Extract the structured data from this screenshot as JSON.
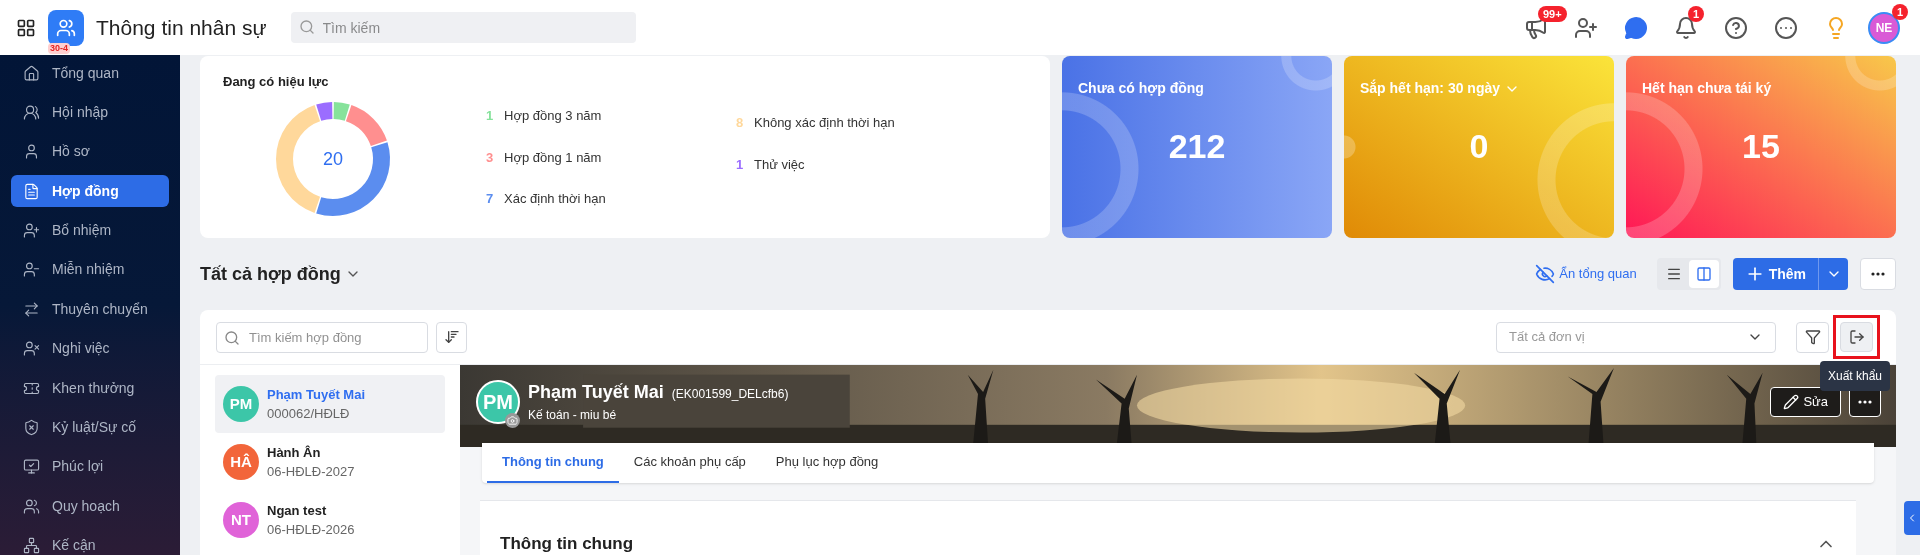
{
  "header": {
    "logo_badge": "30-4",
    "title": "Thông tin nhân sự",
    "search": {
      "placeholder": "Tìm kiếm"
    },
    "actions": [
      {
        "kind": "megaphone",
        "badge": "99+"
      },
      {
        "kind": "user-plus"
      },
      {
        "kind": "chat"
      },
      {
        "kind": "bell",
        "badge": "1"
      },
      {
        "kind": "help"
      },
      {
        "kind": "more"
      },
      {
        "kind": "idea"
      }
    ],
    "avatar": {
      "initials": "NE",
      "badge": "1"
    }
  },
  "sidebar": {
    "items": [
      {
        "label": "Tổng quan",
        "selected": false
      },
      {
        "label": "Hội nhập",
        "selected": false
      },
      {
        "label": "Hồ sơ",
        "selected": false
      },
      {
        "label": "Hợp đồng",
        "selected": true
      },
      {
        "label": "Bổ nhiệm",
        "selected": false
      },
      {
        "label": "Miễn nhiệm",
        "selected": false
      },
      {
        "label": "Thuyên chuyển",
        "selected": false
      },
      {
        "label": "Nghỉ việc",
        "selected": false
      },
      {
        "label": "Khen thưởng",
        "selected": false
      },
      {
        "label": "Kỷ luật/Sự cố",
        "selected": false
      },
      {
        "label": "Phúc lợi",
        "selected": false
      },
      {
        "label": "Quy hoạch",
        "selected": false
      },
      {
        "label": "Kế cận",
        "selected": false
      }
    ]
  },
  "overview": {
    "title": "Đang có hiệu lực",
    "total": "20",
    "chart_data": {
      "type": "donut",
      "categories": [
        "Hợp đồng 3 năm",
        "Hợp đồng 1 năm",
        "Xác định thời hạn",
        "Không xác định thời hạn",
        "Thử việc"
      ],
      "values": [
        5,
        15,
        35,
        40,
        5
      ]
    },
    "legend": [
      {
        "count": "1",
        "color": "#86e29b"
      },
      {
        "count": "3",
        "color": "#ff8f8f"
      },
      {
        "count": "7",
        "color": "#5b8def"
      },
      {
        "count": "8",
        "color": "#ffd89b"
      },
      {
        "count": "1",
        "color": "#9b6dff"
      }
    ]
  },
  "stat_cards": [
    {
      "kind": "blue",
      "title": "Chưa có hợp đồng",
      "value": "212",
      "dropdown": false
    },
    {
      "kind": "yellow",
      "title": "Sắp hết hạn: 30 ngày",
      "value": "0",
      "dropdown": true
    },
    {
      "kind": "red",
      "title": "Hết hạn chưa tái ký",
      "value": "15",
      "dropdown": false
    }
  ],
  "list_header": {
    "title": "Tất cả hợp đồng",
    "hide_overview": "Ẩn tổng quan",
    "view_modes": [
      {
        "kind": "list",
        "selected": false
      },
      {
        "kind": "split",
        "selected": true
      }
    ],
    "add_button": "Thêm"
  },
  "toolbar": {
    "search": {
      "placeholder": "Tìm kiếm hợp đồng"
    },
    "unit_select": {
      "placeholder": "Tất cả đơn vị"
    },
    "export_tooltip": "Xuất khẩu"
  },
  "contracts": [
    {
      "initials": "PM",
      "name": "Phạm Tuyết Mai",
      "code": "000062/HĐLĐ",
      "color": "#3cc6a8",
      "selected": true
    },
    {
      "initials": "HÂ",
      "name": "Hành Ân",
      "code": "06-HĐLĐ-2027",
      "color": "#f2653a",
      "selected": false
    },
    {
      "initials": "NT",
      "name": "Ngan test",
      "code": "06-HĐLĐ-2026",
      "color": "#e063d8",
      "selected": false
    }
  ],
  "detail": {
    "initials": "PM",
    "name": "Phạm Tuyết Mai",
    "code": "(EK001599_DELcfb6)",
    "subtitle": "Kế toán - miu bé",
    "edit_button": "Sửa",
    "tabs": [
      {
        "label": "Thông tin chung",
        "selected": true
      },
      {
        "label": "Các khoản phụ cấp",
        "selected": false
      },
      {
        "label": "Phụ lục hợp đồng",
        "selected": false
      }
    ],
    "section": {
      "title": "Thông tin chung",
      "expanded": true
    }
  }
}
